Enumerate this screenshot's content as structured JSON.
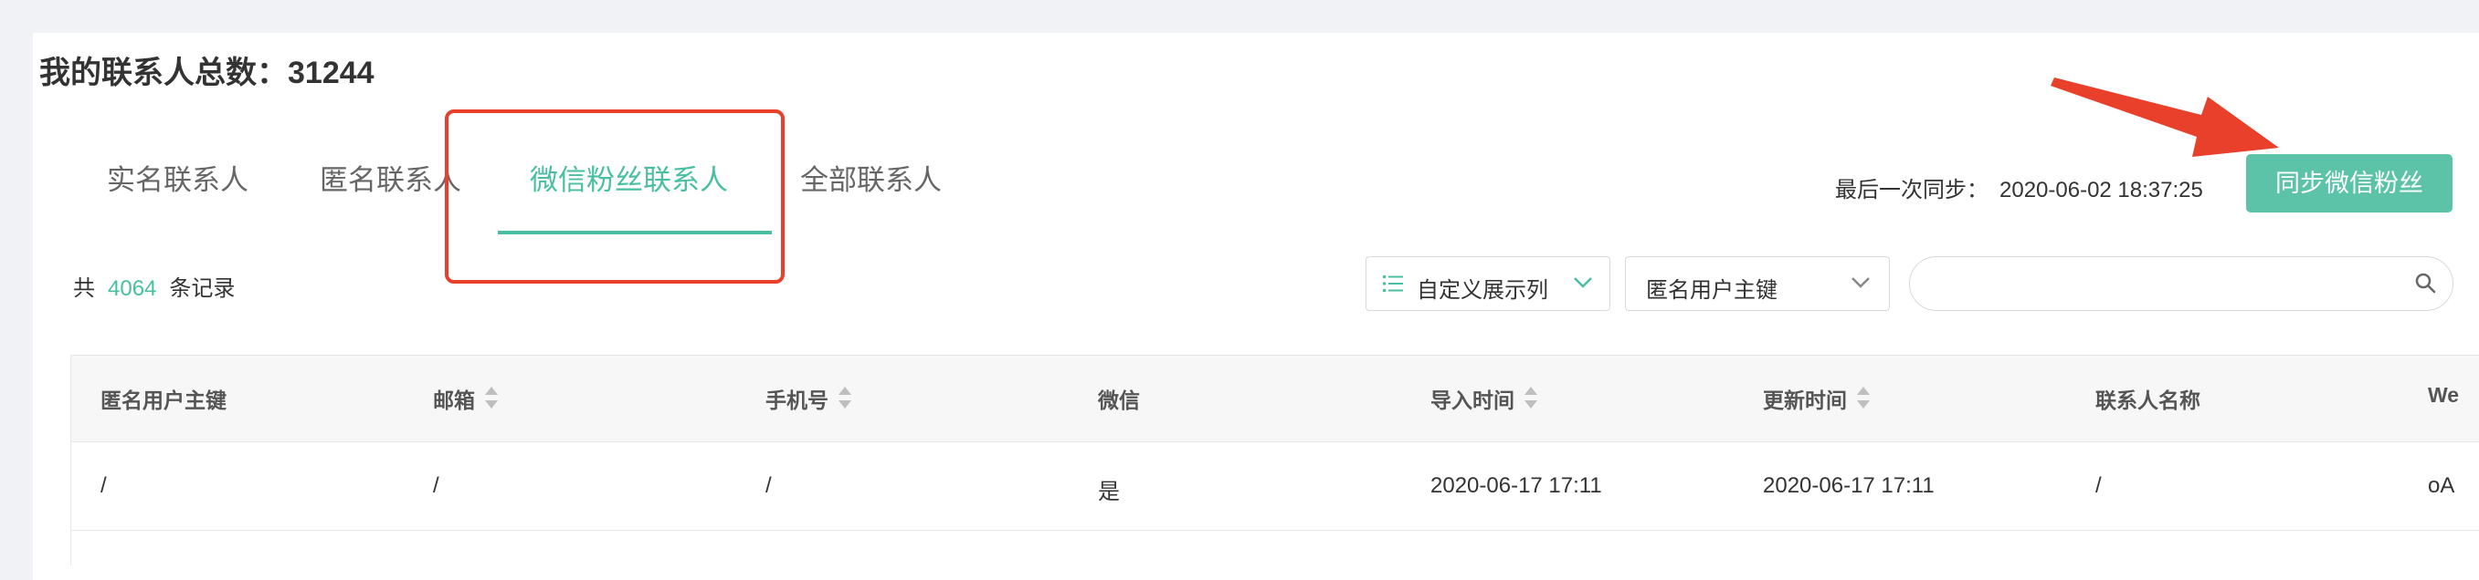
{
  "header": {
    "title": "我的联系人总数：31244"
  },
  "tabs": [
    {
      "label": "实名联系人",
      "active": false
    },
    {
      "label": "匿名联系人",
      "active": false
    },
    {
      "label": "微信粉丝联系人",
      "active": true
    },
    {
      "label": "全部联系人",
      "active": false
    }
  ],
  "sync": {
    "last_sync_label": "最后一次同步：",
    "last_sync_time": "2020-06-02 18:37:25",
    "button_label": "同步微信粉丝"
  },
  "records": {
    "prefix": "共",
    "count": "4064",
    "suffix": "条记录"
  },
  "toolbar": {
    "column_select_label": "自定义展示列",
    "key_select_value": "匿名用户主键",
    "search_placeholder": ""
  },
  "table": {
    "headers": [
      {
        "label": "匿名用户主键",
        "sortable": false
      },
      {
        "label": "邮箱",
        "sortable": true
      },
      {
        "label": "手机号",
        "sortable": true
      },
      {
        "label": "微信",
        "sortable": false
      },
      {
        "label": "导入时间",
        "sortable": true
      },
      {
        "label": "更新时间",
        "sortable": true
      },
      {
        "label": "联系人名称",
        "sortable": false
      },
      {
        "label": "We",
        "sortable": false
      }
    ],
    "rows": [
      [
        "/",
        "/",
        "/",
        "是",
        "2020-06-17 17:11",
        "2020-06-17 17:11",
        "/",
        "oA"
      ]
    ]
  },
  "colors": {
    "accent": "#48bfa2",
    "button": "#5cc3a9",
    "annotation": "#e8402b",
    "background": "#f0f2f5"
  },
  "icons": {
    "column_select": "list-icon",
    "dropdown": "chevron-down-icon",
    "search": "search-icon",
    "sort": "sort-icon",
    "annotation_arrow": "arrow-icon"
  }
}
